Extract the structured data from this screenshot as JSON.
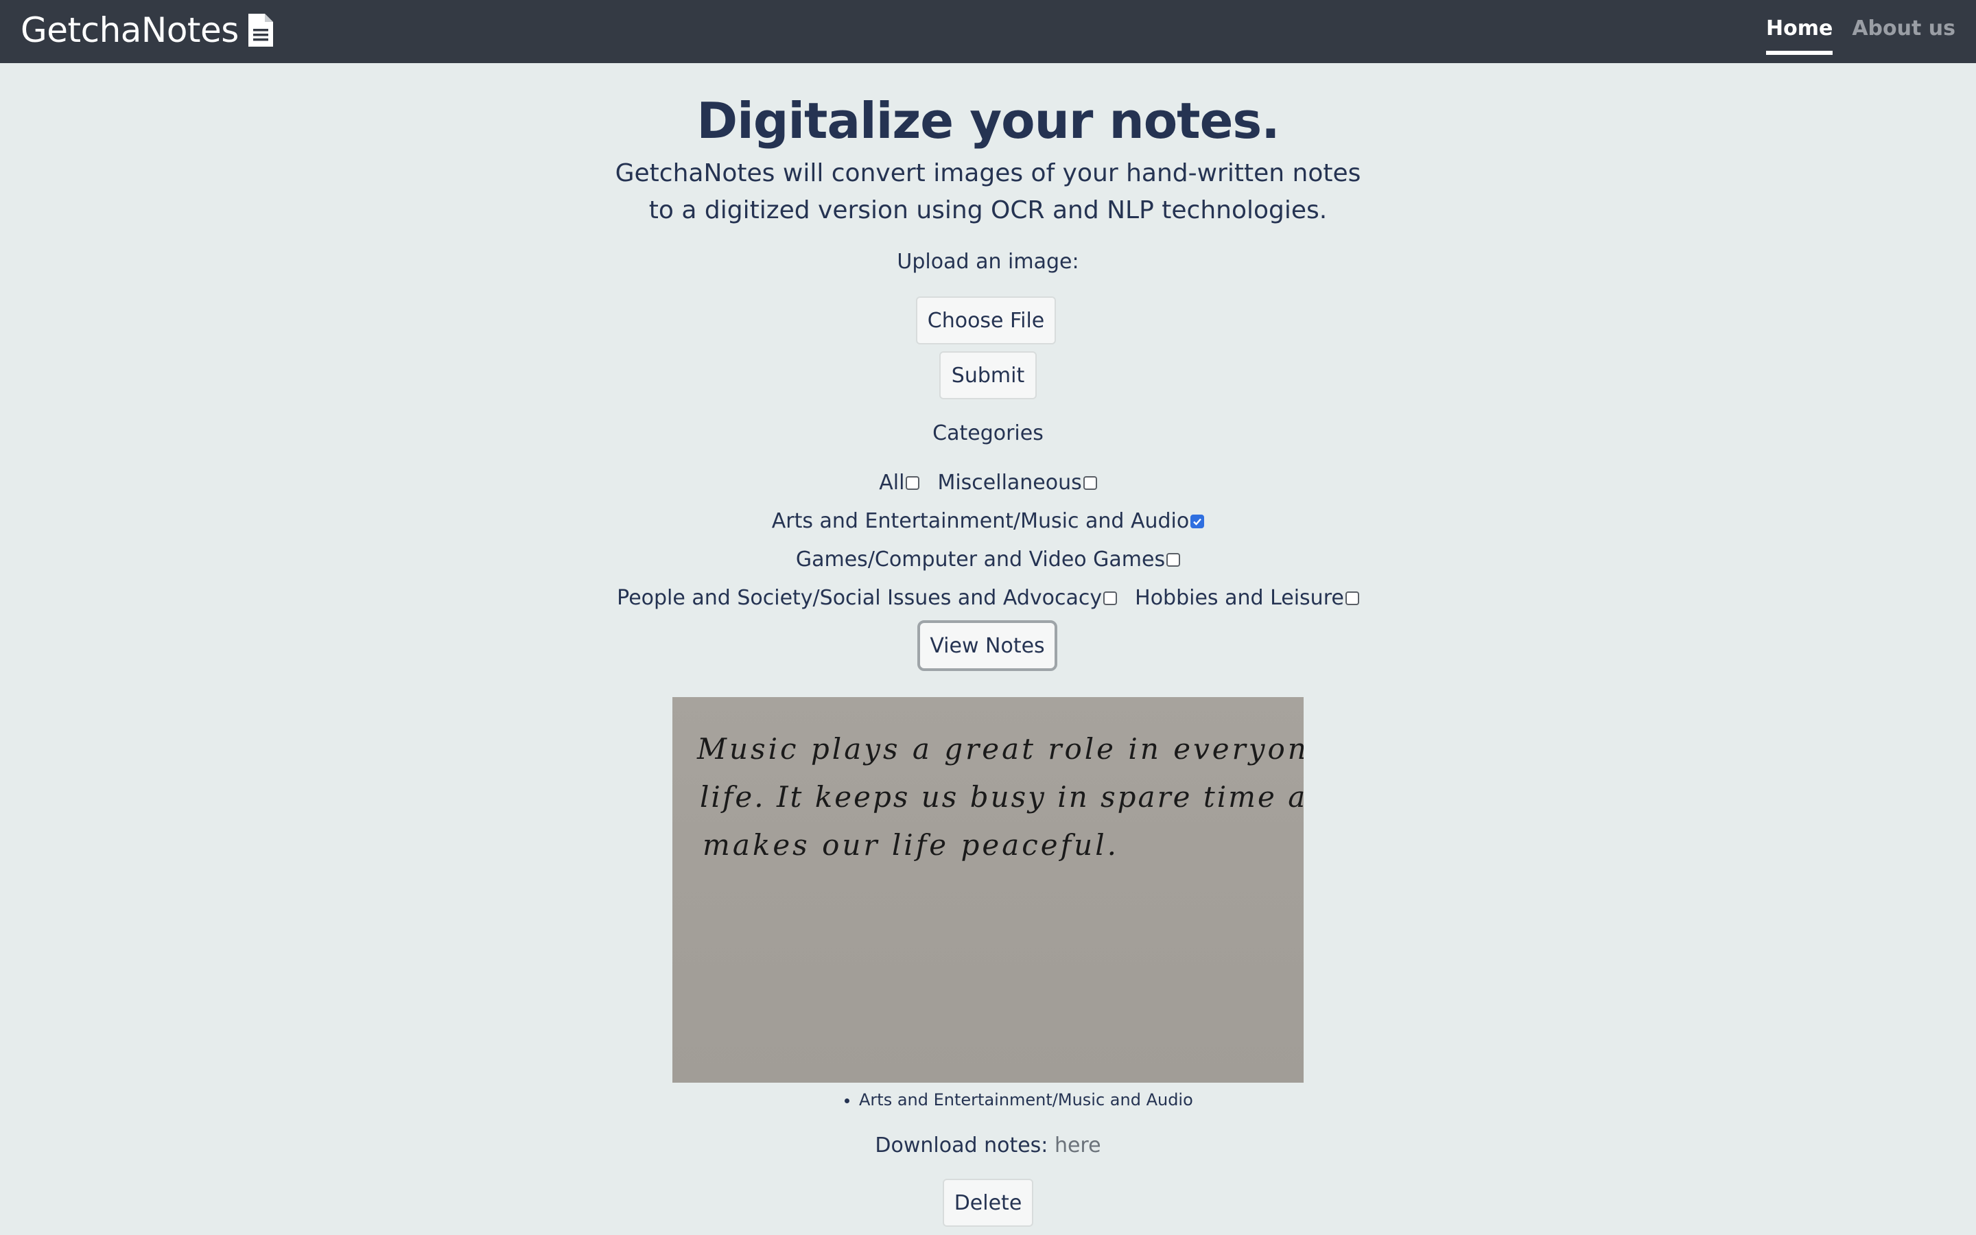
{
  "navbar": {
    "brand": "GetchaNotes",
    "brand_icon": "document-icon",
    "links": [
      {
        "label": "Home",
        "active": true
      },
      {
        "label": "About us",
        "active": false
      }
    ]
  },
  "hero": {
    "title": "Digitalize your notes.",
    "description": "GetchaNotes will convert images of your hand-written notes to a digitized version using OCR and NLP technologies."
  },
  "upload": {
    "label": "Upload an image:",
    "choose_file": "Choose File",
    "submit": "Submit"
  },
  "categories": {
    "title": "Categories",
    "items": [
      {
        "label": "All",
        "checked": false
      },
      {
        "label": "Miscellaneous",
        "checked": false
      },
      {
        "label": "Arts and Entertainment/Music and Audio",
        "checked": true
      },
      {
        "label": "Games/Computer and Video Games",
        "checked": false
      },
      {
        "label": "People and Society/Social Issues and Advocacy",
        "checked": false
      },
      {
        "label": "Hobbies and Leisure",
        "checked": false
      }
    ],
    "view_notes": "View Notes"
  },
  "note": {
    "handwriting_lines": [
      "Music plays a great role in everyone's",
      "life. It keeps us busy in spare time and",
      "makes our life peaceful."
    ],
    "categories": [
      "Arts and Entertainment/Music and Audio"
    ],
    "download_label": "Download notes:",
    "download_link": "here",
    "delete": "Delete"
  },
  "colors": {
    "navbar_bg": "#343a44",
    "page_bg": "#e6ecec",
    "text": "#253352",
    "checkbox_checked": "#2f6fe0"
  }
}
